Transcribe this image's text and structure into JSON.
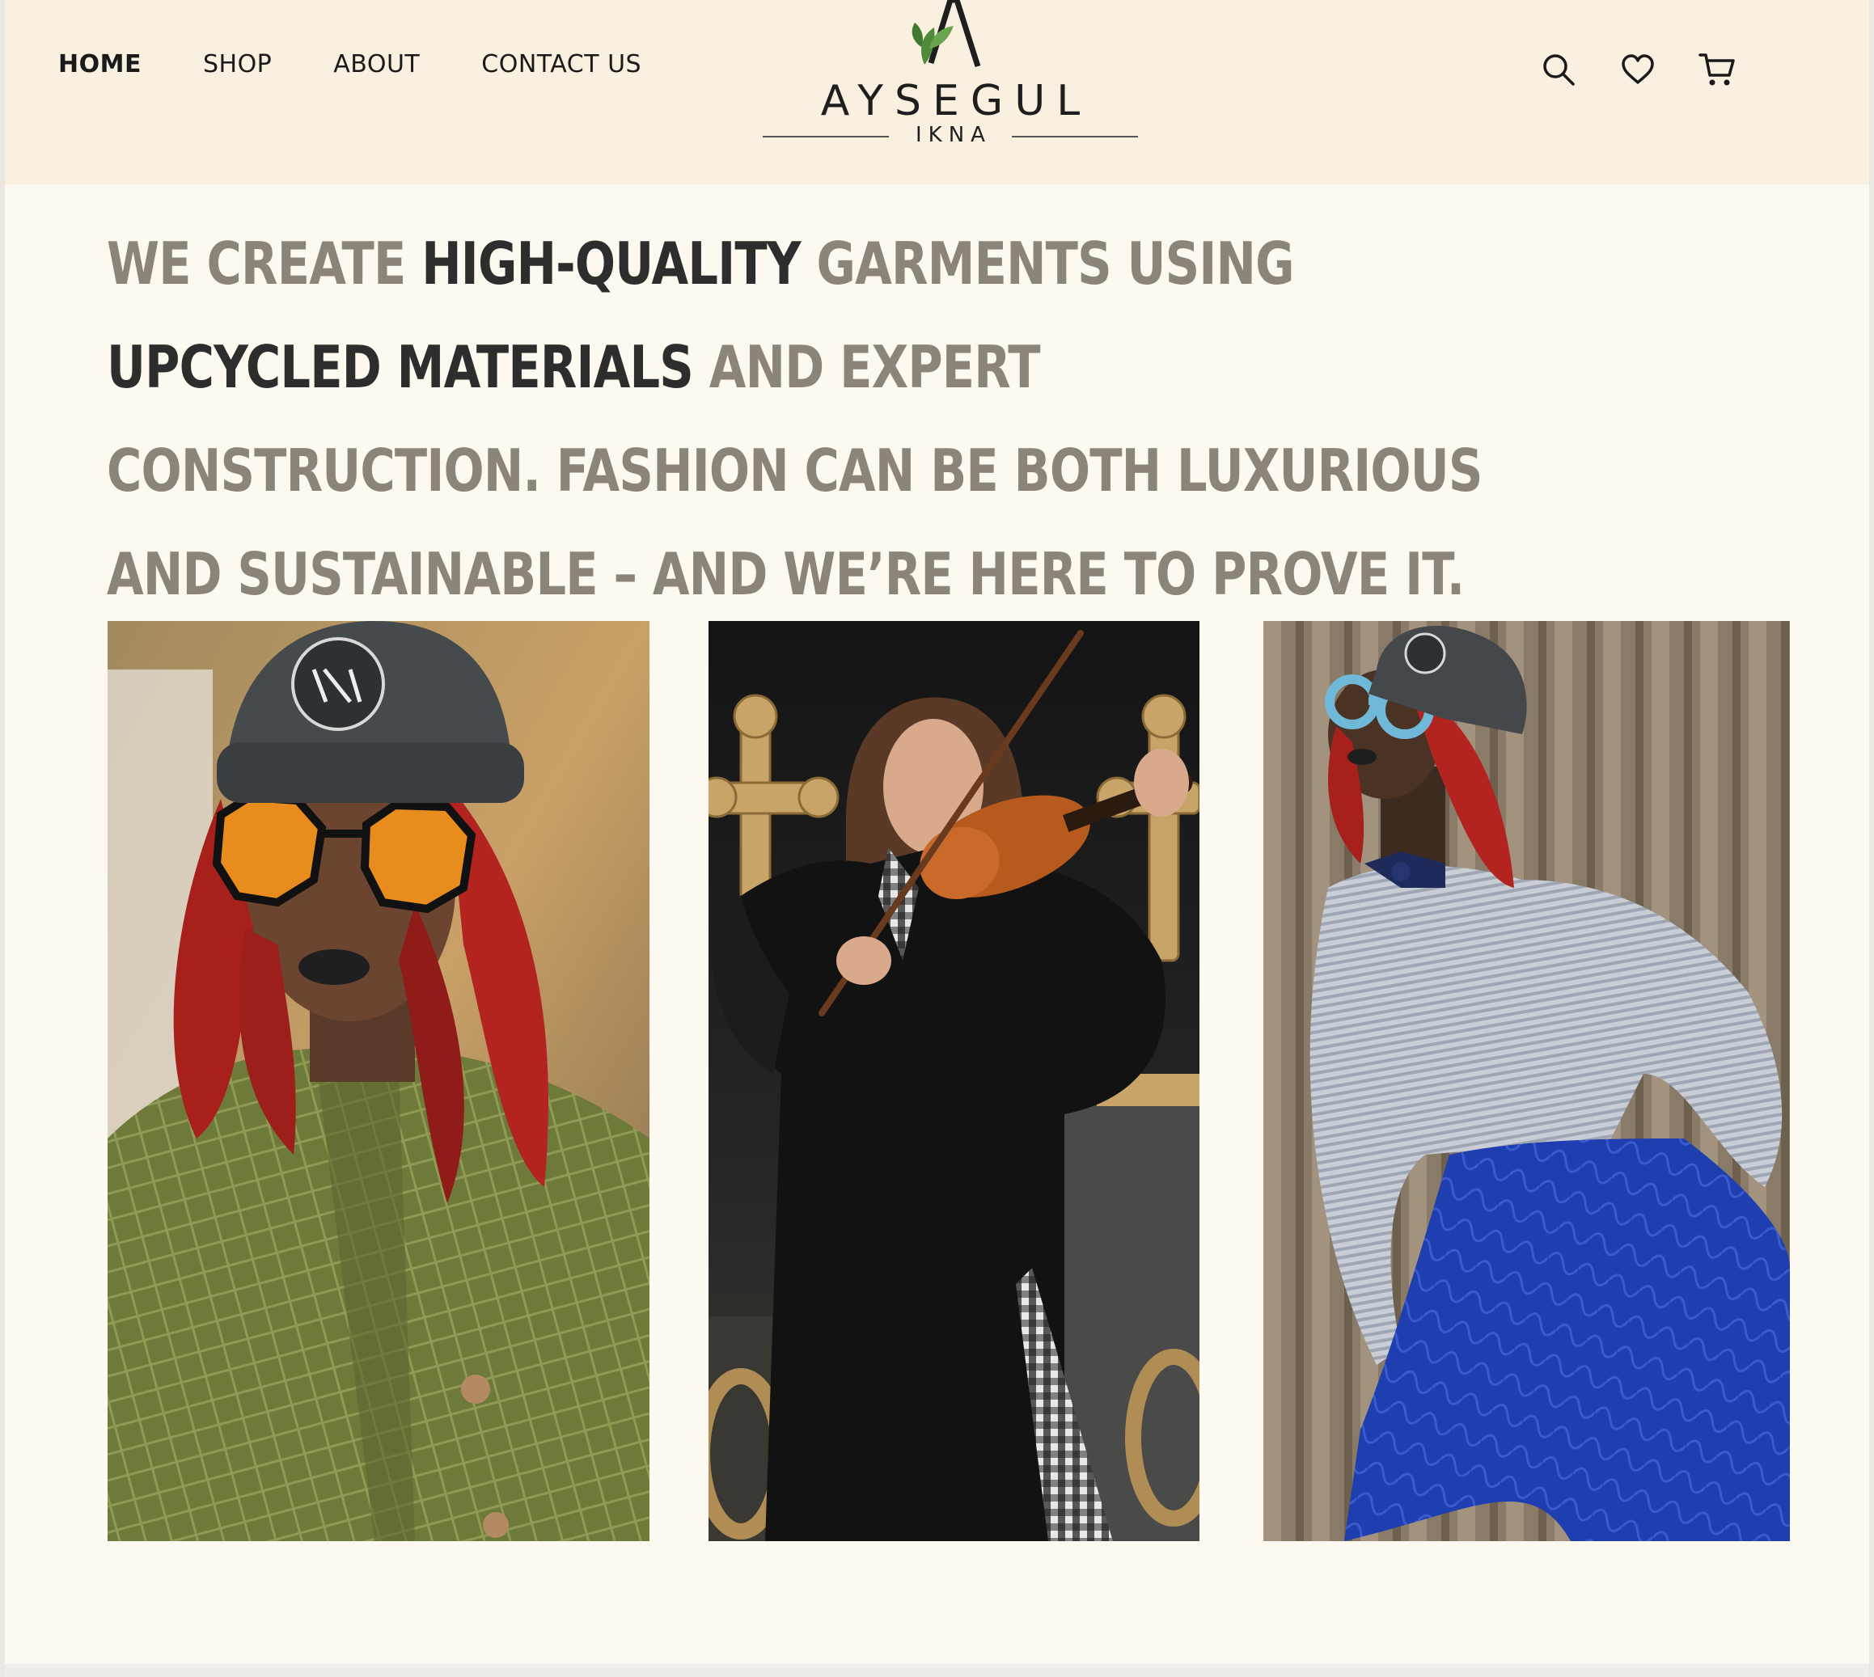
{
  "nav": {
    "items": [
      {
        "label": "HOME",
        "active": true
      },
      {
        "label": "SHOP",
        "active": false
      },
      {
        "label": "ABOUT",
        "active": false
      },
      {
        "label": "CONTACT US",
        "active": false
      }
    ]
  },
  "logo": {
    "name": "AYSEGUL",
    "sub": "IKNA"
  },
  "header_icons": [
    "search-icon",
    "heart-icon",
    "cart-icon"
  ],
  "headline": {
    "parts": [
      {
        "text": "We create ",
        "emphasis": false
      },
      {
        "text": "high-quality",
        "emphasis": true
      },
      {
        "text": " garments using ",
        "emphasis": false
      },
      {
        "text": "upcycled materials",
        "emphasis": true
      },
      {
        "text": " and expert construction. Fashion can be both luxurious and sustainable – and we’re here to prove it.",
        "emphasis": false
      }
    ]
  },
  "colors": {
    "header_bg": "#faf0e0",
    "page_bg": "#fdf9f0",
    "headline_muted": "#8a8578",
    "headline_strong": "#2d2d2d",
    "logo_leaf": "#4e8a3a"
  },
  "gallery": [
    {
      "subject": "Model in grey beanie, orange hexagonal sunglasses, red locs and quilted olive green jacket"
    },
    {
      "subject": "Woman playing violin in black eyelet dress in front of dark door with gold crosses"
    },
    {
      "subject": "Model in grey beanie, blue round glasses, bow tie, striped shirt and quilted blue trousers"
    }
  ]
}
